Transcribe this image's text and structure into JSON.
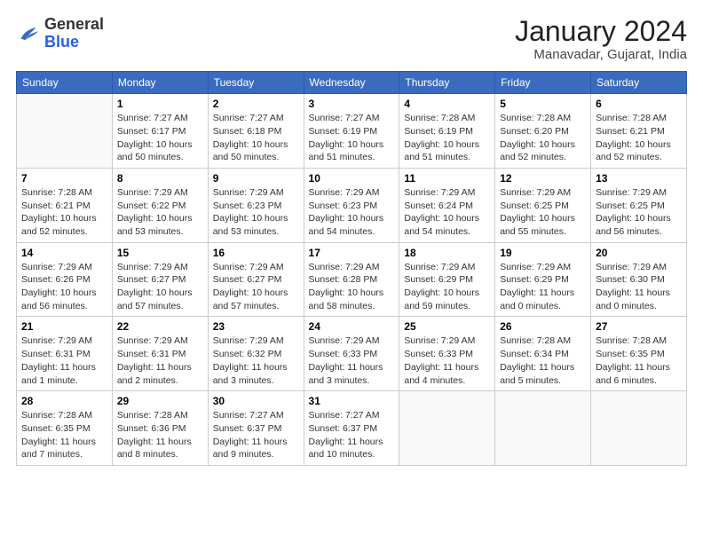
{
  "header": {
    "logo_general": "General",
    "logo_blue": "Blue",
    "month_title": "January 2024",
    "location": "Manavadar, Gujarat, India"
  },
  "days_of_week": [
    "Sunday",
    "Monday",
    "Tuesday",
    "Wednesday",
    "Thursday",
    "Friday",
    "Saturday"
  ],
  "weeks": [
    [
      {
        "num": "",
        "empty": true
      },
      {
        "num": "1",
        "sunrise": "7:27 AM",
        "sunset": "6:17 PM",
        "daylight": "10 hours and 50 minutes."
      },
      {
        "num": "2",
        "sunrise": "7:27 AM",
        "sunset": "6:18 PM",
        "daylight": "10 hours and 50 minutes."
      },
      {
        "num": "3",
        "sunrise": "7:27 AM",
        "sunset": "6:19 PM",
        "daylight": "10 hours and 51 minutes."
      },
      {
        "num": "4",
        "sunrise": "7:28 AM",
        "sunset": "6:19 PM",
        "daylight": "10 hours and 51 minutes."
      },
      {
        "num": "5",
        "sunrise": "7:28 AM",
        "sunset": "6:20 PM",
        "daylight": "10 hours and 52 minutes."
      },
      {
        "num": "6",
        "sunrise": "7:28 AM",
        "sunset": "6:21 PM",
        "daylight": "10 hours and 52 minutes."
      }
    ],
    [
      {
        "num": "7",
        "sunrise": "7:28 AM",
        "sunset": "6:21 PM",
        "daylight": "10 hours and 52 minutes."
      },
      {
        "num": "8",
        "sunrise": "7:29 AM",
        "sunset": "6:22 PM",
        "daylight": "10 hours and 53 minutes."
      },
      {
        "num": "9",
        "sunrise": "7:29 AM",
        "sunset": "6:23 PM",
        "daylight": "10 hours and 53 minutes."
      },
      {
        "num": "10",
        "sunrise": "7:29 AM",
        "sunset": "6:23 PM",
        "daylight": "10 hours and 54 minutes."
      },
      {
        "num": "11",
        "sunrise": "7:29 AM",
        "sunset": "6:24 PM",
        "daylight": "10 hours and 54 minutes."
      },
      {
        "num": "12",
        "sunrise": "7:29 AM",
        "sunset": "6:25 PM",
        "daylight": "10 hours and 55 minutes."
      },
      {
        "num": "13",
        "sunrise": "7:29 AM",
        "sunset": "6:25 PM",
        "daylight": "10 hours and 56 minutes."
      }
    ],
    [
      {
        "num": "14",
        "sunrise": "7:29 AM",
        "sunset": "6:26 PM",
        "daylight": "10 hours and 56 minutes."
      },
      {
        "num": "15",
        "sunrise": "7:29 AM",
        "sunset": "6:27 PM",
        "daylight": "10 hours and 57 minutes."
      },
      {
        "num": "16",
        "sunrise": "7:29 AM",
        "sunset": "6:27 PM",
        "daylight": "10 hours and 57 minutes."
      },
      {
        "num": "17",
        "sunrise": "7:29 AM",
        "sunset": "6:28 PM",
        "daylight": "10 hours and 58 minutes."
      },
      {
        "num": "18",
        "sunrise": "7:29 AM",
        "sunset": "6:29 PM",
        "daylight": "10 hours and 59 minutes."
      },
      {
        "num": "19",
        "sunrise": "7:29 AM",
        "sunset": "6:29 PM",
        "daylight": "11 hours and 0 minutes."
      },
      {
        "num": "20",
        "sunrise": "7:29 AM",
        "sunset": "6:30 PM",
        "daylight": "11 hours and 0 minutes."
      }
    ],
    [
      {
        "num": "21",
        "sunrise": "7:29 AM",
        "sunset": "6:31 PM",
        "daylight": "11 hours and 1 minute."
      },
      {
        "num": "22",
        "sunrise": "7:29 AM",
        "sunset": "6:31 PM",
        "daylight": "11 hours and 2 minutes."
      },
      {
        "num": "23",
        "sunrise": "7:29 AM",
        "sunset": "6:32 PM",
        "daylight": "11 hours and 3 minutes."
      },
      {
        "num": "24",
        "sunrise": "7:29 AM",
        "sunset": "6:33 PM",
        "daylight": "11 hours and 3 minutes."
      },
      {
        "num": "25",
        "sunrise": "7:29 AM",
        "sunset": "6:33 PM",
        "daylight": "11 hours and 4 minutes."
      },
      {
        "num": "26",
        "sunrise": "7:28 AM",
        "sunset": "6:34 PM",
        "daylight": "11 hours and 5 minutes."
      },
      {
        "num": "27",
        "sunrise": "7:28 AM",
        "sunset": "6:35 PM",
        "daylight": "11 hours and 6 minutes."
      }
    ],
    [
      {
        "num": "28",
        "sunrise": "7:28 AM",
        "sunset": "6:35 PM",
        "daylight": "11 hours and 7 minutes."
      },
      {
        "num": "29",
        "sunrise": "7:28 AM",
        "sunset": "6:36 PM",
        "daylight": "11 hours and 8 minutes."
      },
      {
        "num": "30",
        "sunrise": "7:27 AM",
        "sunset": "6:37 PM",
        "daylight": "11 hours and 9 minutes."
      },
      {
        "num": "31",
        "sunrise": "7:27 AM",
        "sunset": "6:37 PM",
        "daylight": "11 hours and 10 minutes."
      },
      {
        "num": "",
        "empty": true
      },
      {
        "num": "",
        "empty": true
      },
      {
        "num": "",
        "empty": true
      }
    ]
  ]
}
